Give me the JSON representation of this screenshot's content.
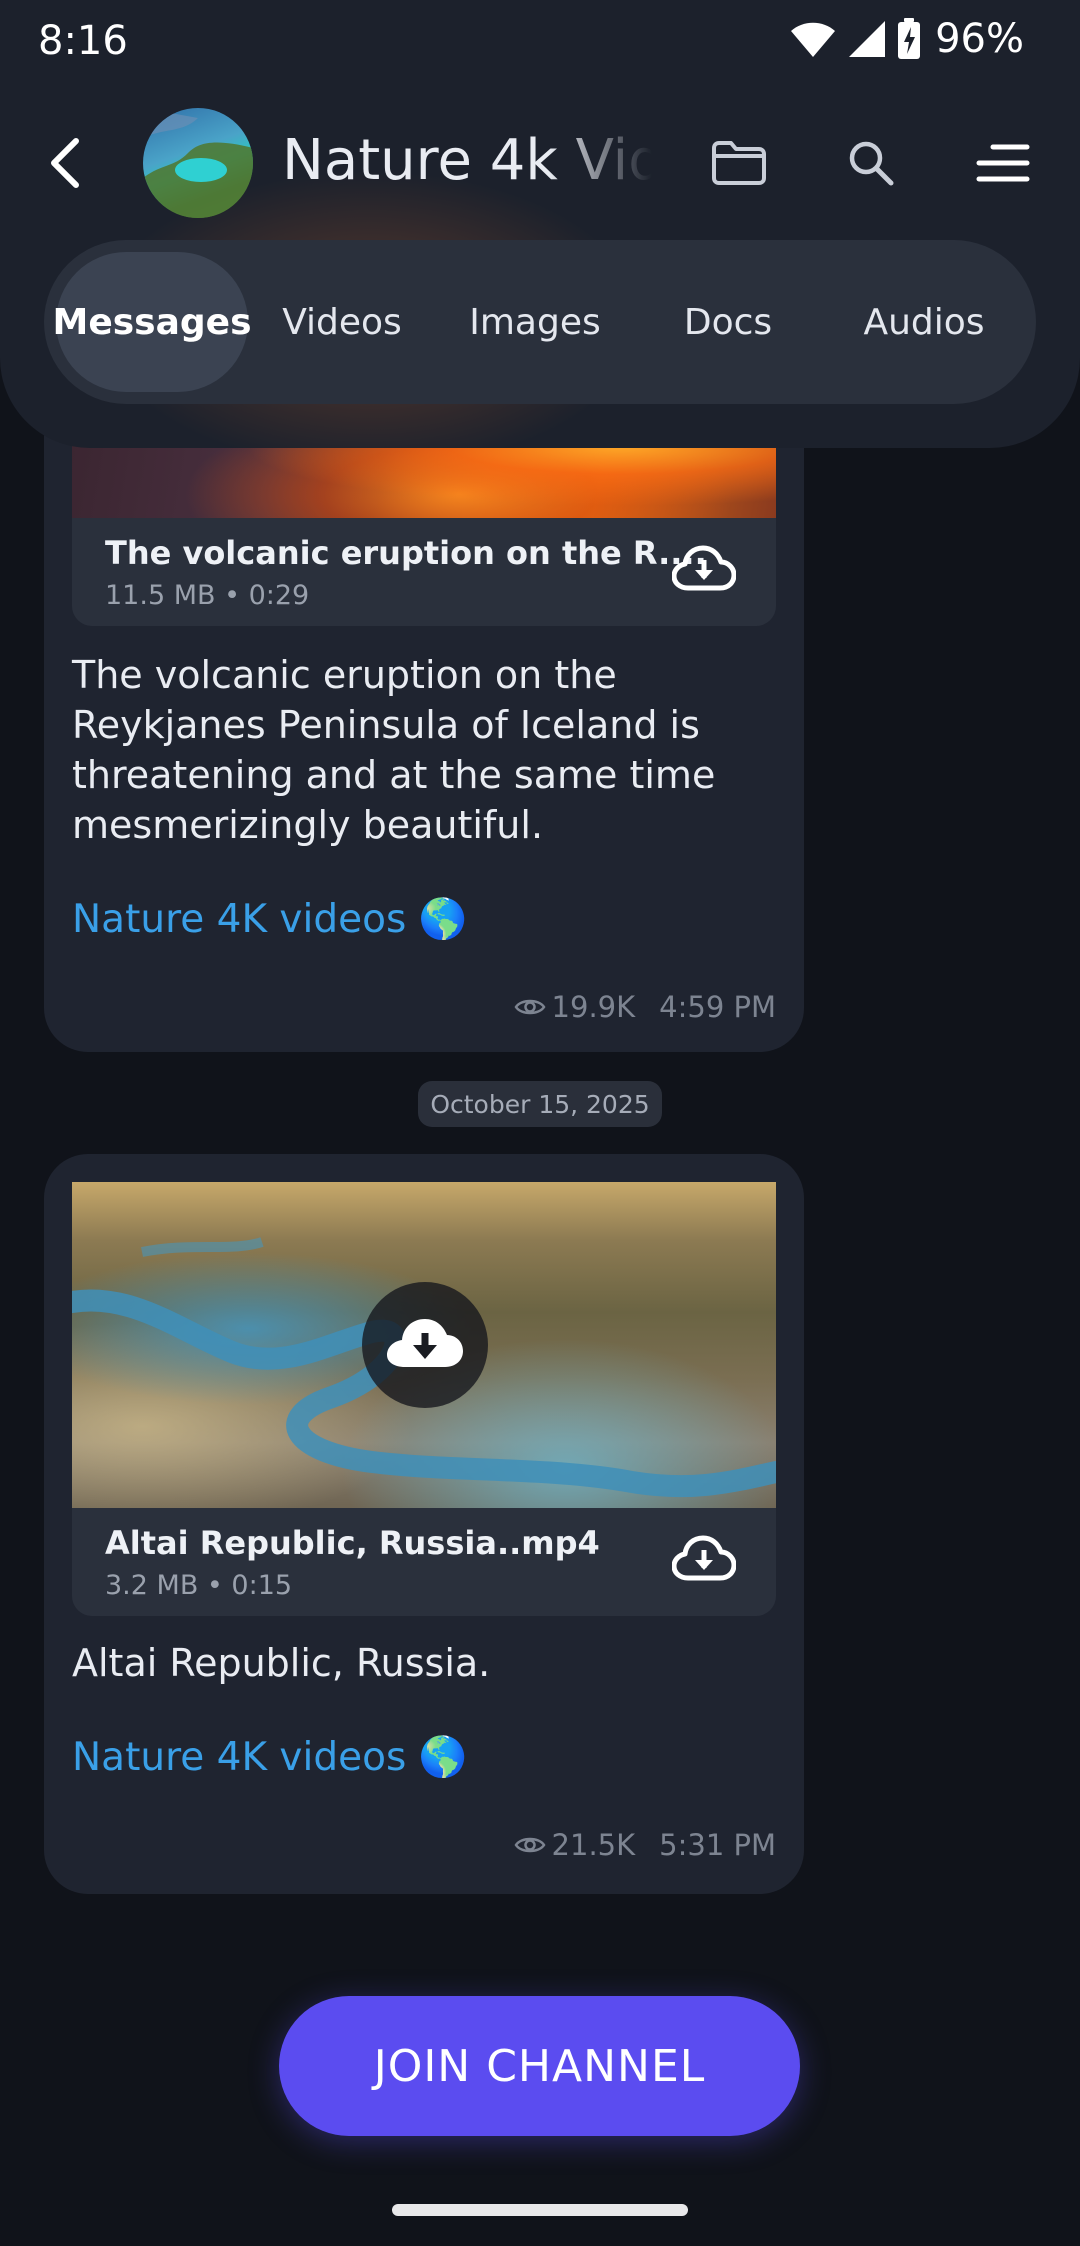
{
  "status_bar": {
    "time": "8:16",
    "battery_percent": "96%",
    "icons": [
      "wifi-icon",
      "cell-signal-icon",
      "battery-charging-icon"
    ]
  },
  "header": {
    "title": "Nature 4k Vid",
    "icons": [
      "back-arrow-icon",
      "folder-icon",
      "search-icon",
      "menu-icon"
    ]
  },
  "tabs": [
    {
      "label": "Messages",
      "active": true
    },
    {
      "label": "Videos",
      "active": false
    },
    {
      "label": "Images",
      "active": false
    },
    {
      "label": "Docs",
      "active": false
    },
    {
      "label": "Audios",
      "active": false
    }
  ],
  "messages": [
    {
      "file_name": "The volcanic eruption on the R....",
      "file_meta": "11.5 MB • 0:29",
      "caption": "The volcanic eruption on the Reykjanes Peninsula of Iceland is threatening and at the same time mesmerizingly beautiful.",
      "channel_link": "Nature 4K videos 🌎",
      "views": "19.9K",
      "time": "4:59 PM"
    },
    {
      "file_name": "Altai Republic, Russia..mp4",
      "file_meta": "3.2 MB • 0:15",
      "caption": "Altai Republic, Russia.",
      "channel_link": "Nature 4K videos 🌎",
      "views": "21.5K",
      "time": "5:31 PM"
    }
  ],
  "date_separator": "October 15, 2025",
  "join_button": "JOIN CHANNEL",
  "colors": {
    "accent": "#5b4cf0",
    "link": "#3aa0e8",
    "card": "#1f2430",
    "background": "#10131a"
  }
}
